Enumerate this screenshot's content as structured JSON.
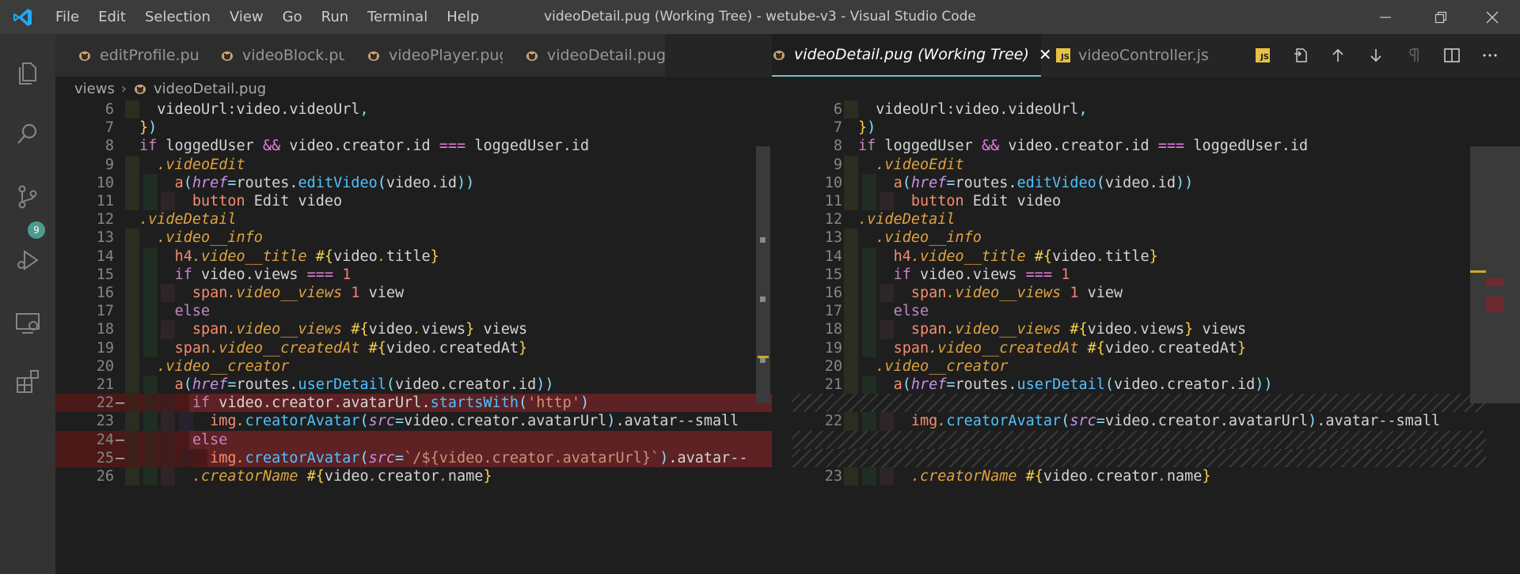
{
  "window": {
    "title": "videoDetail.pug (Working Tree) - wetube-v3 - Visual Studio Code"
  },
  "menu": [
    "File",
    "Edit",
    "Selection",
    "View",
    "Go",
    "Run",
    "Terminal",
    "Help"
  ],
  "activity": {
    "scm_badge": "9"
  },
  "tabs": [
    {
      "label": "editProfile.pug",
      "icon": "pug-icon"
    },
    {
      "label": "videoBlock.pug",
      "icon": "pug-icon"
    },
    {
      "label": "videoPlayer.pug",
      "icon": "pug-icon"
    },
    {
      "label": "videoDetail.pug",
      "icon": "pug-icon"
    },
    {
      "label": "videoDetail.pug (Working Tree)",
      "icon": "pug-icon",
      "active": true,
      "close": "✕"
    },
    {
      "label": "videoController.js",
      "icon": "js-icon",
      "badge": "JS"
    }
  ],
  "toolbar": {
    "js_badge": "JS"
  },
  "breadcrumb": {
    "folder": "views",
    "file": "videoDetail.pug"
  },
  "left": {
    "lines": [
      {
        "n": "6",
        "code": "  videoUrl:video.videoUrl,"
      },
      {
        "n": "7",
        "code": "})"
      },
      {
        "n": "8",
        "code": "if loggedUser && video.creator.id === loggedUser.id"
      },
      {
        "n": "9",
        "code": "  .videoEdit"
      },
      {
        "n": "10",
        "code": "    a(href=routes.editVideo(video.id))"
      },
      {
        "n": "11",
        "code": "      button Edit video"
      },
      {
        "n": "12",
        "code": ".videDetail"
      },
      {
        "n": "13",
        "code": "  .video__info"
      },
      {
        "n": "14",
        "code": "    h4.video__title #{video.title}"
      },
      {
        "n": "15",
        "code": "    if video.views === 1"
      },
      {
        "n": "16",
        "code": "      span.video__views 1 view"
      },
      {
        "n": "17",
        "code": "    else"
      },
      {
        "n": "18",
        "code": "      span.video__views #{video.views} views"
      },
      {
        "n": "19",
        "code": "    span.video__createdAt #{video.createdAt}"
      },
      {
        "n": "20",
        "code": "  .video__creator"
      },
      {
        "n": "21",
        "code": "    a(href=routes.userDetail(video.creator.id))"
      },
      {
        "n": "22",
        "code": "      if video.creator.avatarUrl.startsWith('http')",
        "del": true
      },
      {
        "n": "23",
        "code": "        img.creatorAvatar(src=video.creator.avatarUrl).avatar--small"
      },
      {
        "n": "24",
        "code": "      else",
        "del": true
      },
      {
        "n": "25",
        "code": "        img.creatorAvatar(src=`/${video.creator.avatarUrl}`).avatar--",
        "del": true
      },
      {
        "n": "26",
        "code": "      .creatorName #{video.creator.name}"
      }
    ]
  },
  "right": {
    "lines": [
      {
        "n": "6",
        "code": "  videoUrl:video.videoUrl,"
      },
      {
        "n": "7",
        "code": "})"
      },
      {
        "n": "8",
        "code": "if loggedUser && video.creator.id === loggedUser.id"
      },
      {
        "n": "9",
        "code": "  .videoEdit"
      },
      {
        "n": "10",
        "code": "    a(href=routes.editVideo(video.id))"
      },
      {
        "n": "11",
        "code": "      button Edit video"
      },
      {
        "n": "12",
        "code": ".videDetail"
      },
      {
        "n": "13",
        "code": "  .video__info"
      },
      {
        "n": "14",
        "code": "    h4.video__title #{video.title}"
      },
      {
        "n": "15",
        "code": "    if video.views === 1"
      },
      {
        "n": "16",
        "code": "      span.video__views 1 view"
      },
      {
        "n": "17",
        "code": "    else"
      },
      {
        "n": "18",
        "code": "      span.video__views #{video.views} views"
      },
      {
        "n": "19",
        "code": "    span.video__createdAt #{video.createdAt}"
      },
      {
        "n": "20",
        "code": "  .video__creator"
      },
      {
        "n": "21",
        "code": "    a(href=routes.userDetail(video.creator.id))"
      },
      {
        "n": "",
        "code": "",
        "hatch": true
      },
      {
        "n": "22",
        "code": "      img.creatorAvatar(src=video.creator.avatarUrl).avatar--small"
      },
      {
        "n": "",
        "code": "",
        "hatch": true
      },
      {
        "n": "",
        "code": "",
        "hatch": true
      },
      {
        "n": "23",
        "code": "      .creatorName #{video.creator.name}"
      }
    ]
  }
}
